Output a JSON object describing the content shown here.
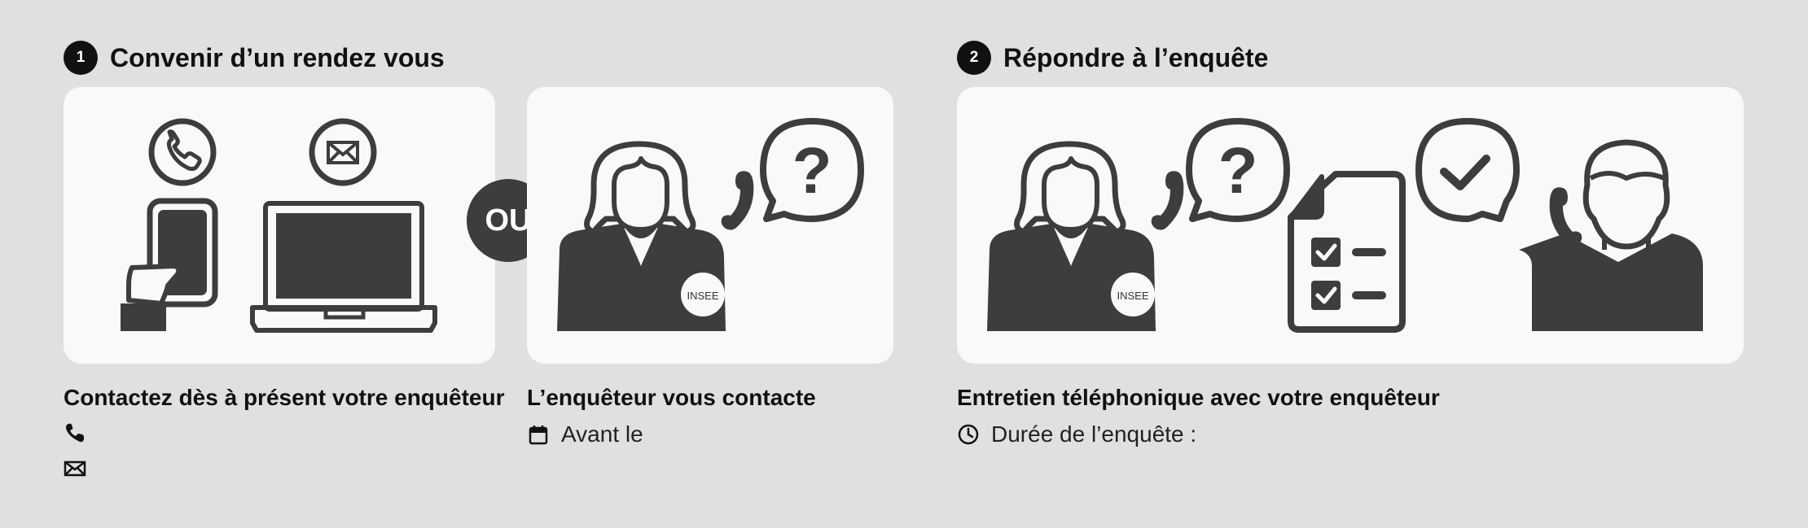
{
  "step1": {
    "number": "1",
    "title": "Convenir d’un rendez vous"
  },
  "step2": {
    "number": "2",
    "title": "Répondre à l’enquête"
  },
  "or_label": "OU",
  "badge_label": "INSEE",
  "captions": {
    "contact_now": "Contactez dès à présent votre enquêteur",
    "investigator_contacts": "L’enquêteur vous contacte",
    "phone_interview": "Entretien téléphonique avec votre enquêteur"
  },
  "info": {
    "before": "Avant le",
    "duration": "Durée de l’enquête :"
  },
  "icons": {
    "phone": "phone-icon",
    "email": "envelope-icon",
    "calendar": "calendar-icon",
    "clock": "clock-icon"
  },
  "colors": {
    "background": "#e0e0e0",
    "card": "#f9f9f9",
    "illustration": "#3d3d3d",
    "text": "#111111"
  }
}
